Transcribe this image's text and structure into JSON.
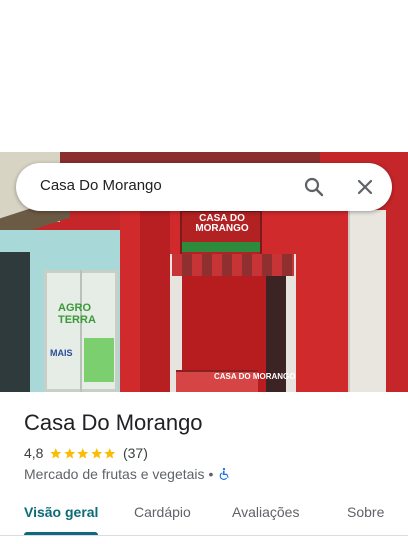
{
  "search": {
    "query": "Casa Do Morango"
  },
  "icons": {
    "search": "search-icon",
    "close": "close-icon",
    "star": "star-icon",
    "accessible": "wheelchair-icon"
  },
  "place": {
    "title": "Casa Do Morango",
    "rating": "4,8",
    "rating_value": 4.8,
    "stars_max": 5,
    "review_count": "(37)",
    "category": "Mercado de frutas e vegetais",
    "separator": "•"
  },
  "photo_text": {
    "store_sign": "CASA DO MORANGO",
    "counter_sign": "CASA DO MORANGO",
    "agro": "AGRO TERRA",
    "mais": "MAIS"
  },
  "tabs": [
    {
      "label": "Visão geral",
      "active": true
    },
    {
      "label": "Cardápio",
      "active": false
    },
    {
      "label": "Avaliações",
      "active": false
    },
    {
      "label": "Sobre",
      "active": false
    }
  ],
  "colors": {
    "accent": "#0b6b78",
    "star": "#fbbc04",
    "accessible_icon": "#1a73e8"
  }
}
